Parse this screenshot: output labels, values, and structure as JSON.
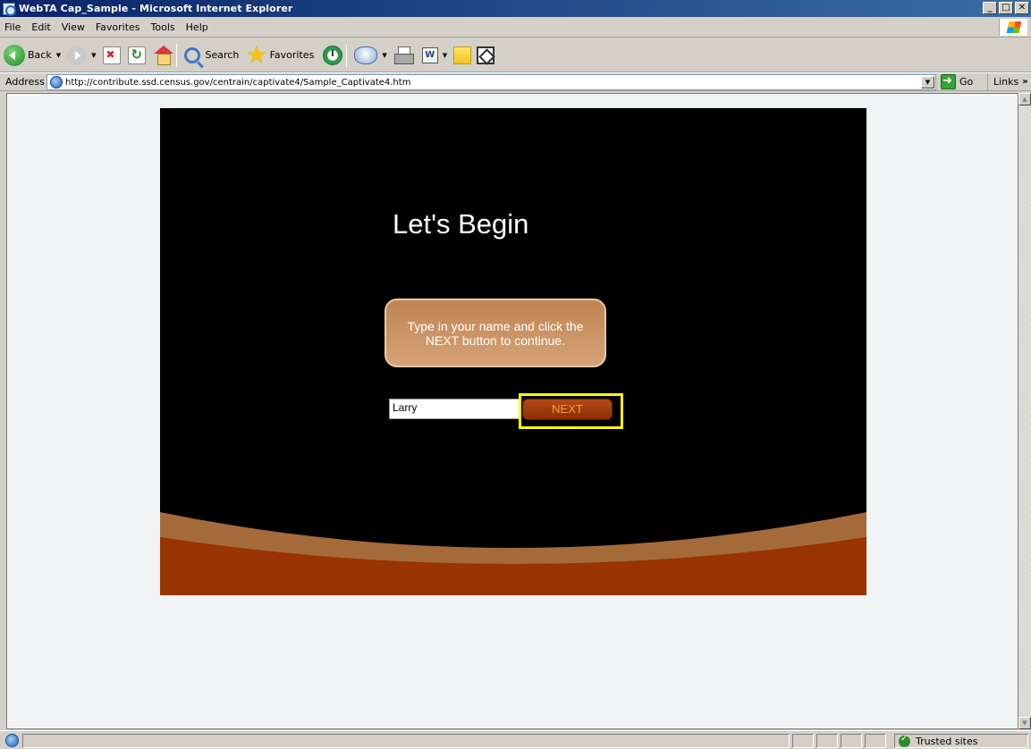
{
  "window": {
    "title": "WebTA Cap_Sample - Microsoft Internet Explorer",
    "min_label": "_",
    "max_label": "□",
    "close_label": "✕"
  },
  "menubar": {
    "items": [
      "File",
      "Edit",
      "View",
      "Favorites",
      "Tools",
      "Help"
    ]
  },
  "toolbar": {
    "back_label": "Back",
    "search_label": "Search",
    "favorites_label": "Favorites",
    "word_glyph": "W"
  },
  "addressbar": {
    "label": "Address",
    "url": "http://contribute.ssd.census.gov/centrain/captivate4/Sample_Captivate4.htm",
    "go_label": "Go",
    "links_label": "Links",
    "links_chevron": "»"
  },
  "stage": {
    "title": "Let's Begin",
    "callout_text": "Type in your name and click the NEXT button to continue.",
    "name_value": "Larry",
    "next_label": "NEXT"
  },
  "statusbar": {
    "zone_label": "Trusted sites"
  },
  "colors": {
    "stage_bg": "#000000",
    "swoosh_light": "#a56a3a",
    "swoosh_dark": "#993300",
    "highlight": "#ffff00",
    "callout": "#c88f5e"
  }
}
